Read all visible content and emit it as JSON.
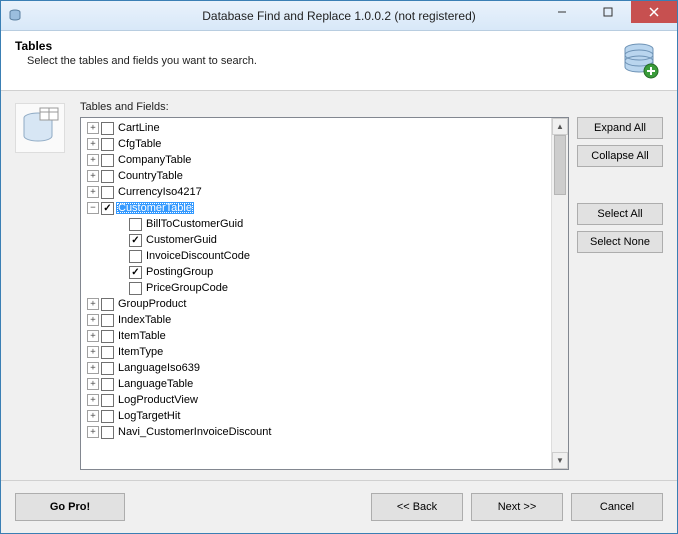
{
  "window": {
    "title": "Database Find and Replace 1.0.0.2 (not registered)"
  },
  "header": {
    "title": "Tables",
    "subtitle": "Select the tables and fields you want to search."
  },
  "treeLabel": "Tables and Fields:",
  "tree": {
    "items": [
      {
        "label": "CartLine",
        "level": 0,
        "expandable": true,
        "expanded": false,
        "checked": false
      },
      {
        "label": "CfgTable",
        "level": 0,
        "expandable": true,
        "expanded": false,
        "checked": false
      },
      {
        "label": "CompanyTable",
        "level": 0,
        "expandable": true,
        "expanded": false,
        "checked": false
      },
      {
        "label": "CountryTable",
        "level": 0,
        "expandable": true,
        "expanded": false,
        "checked": false
      },
      {
        "label": "CurrencyIso4217",
        "level": 0,
        "expandable": true,
        "expanded": false,
        "checked": false
      },
      {
        "label": "CustomerTable",
        "level": 0,
        "expandable": true,
        "expanded": true,
        "checked": true,
        "selected": true
      },
      {
        "label": "BillToCustomerGuid",
        "level": 1,
        "expandable": false,
        "checked": false
      },
      {
        "label": "CustomerGuid",
        "level": 1,
        "expandable": false,
        "checked": true
      },
      {
        "label": "InvoiceDiscountCode",
        "level": 1,
        "expandable": false,
        "checked": false
      },
      {
        "label": "PostingGroup",
        "level": 1,
        "expandable": false,
        "checked": true
      },
      {
        "label": "PriceGroupCode",
        "level": 1,
        "expandable": false,
        "checked": false
      },
      {
        "label": "GroupProduct",
        "level": 0,
        "expandable": true,
        "expanded": false,
        "checked": false
      },
      {
        "label": "IndexTable",
        "level": 0,
        "expandable": true,
        "expanded": false,
        "checked": false
      },
      {
        "label": "ItemTable",
        "level": 0,
        "expandable": true,
        "expanded": false,
        "checked": false
      },
      {
        "label": "ItemType",
        "level": 0,
        "expandable": true,
        "expanded": false,
        "checked": false
      },
      {
        "label": "LanguageIso639",
        "level": 0,
        "expandable": true,
        "expanded": false,
        "checked": false
      },
      {
        "label": "LanguageTable",
        "level": 0,
        "expandable": true,
        "expanded": false,
        "checked": false
      },
      {
        "label": "LogProductView",
        "level": 0,
        "expandable": true,
        "expanded": false,
        "checked": false
      },
      {
        "label": "LogTargetHit",
        "level": 0,
        "expandable": true,
        "expanded": false,
        "checked": false
      },
      {
        "label": "Navi_CustomerInvoiceDiscount",
        "level": 0,
        "expandable": true,
        "expanded": false,
        "checked": false
      }
    ]
  },
  "sideButtons": {
    "expandAll": "Expand All",
    "collapseAll": "Collapse All",
    "selectAll": "Select All",
    "selectNone": "Select None"
  },
  "footer": {
    "goPro": "Go Pro!",
    "back": "<< Back",
    "next": "Next >>",
    "cancel": "Cancel"
  }
}
